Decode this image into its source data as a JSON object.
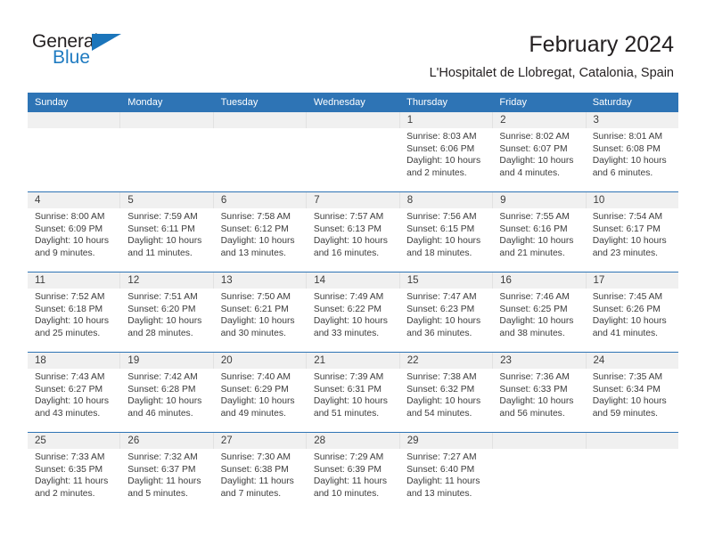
{
  "brand": {
    "name_part1": "General",
    "name_part2": "Blue",
    "triangle_icon": "triangle-icon",
    "accent_color": "#1b75bb"
  },
  "header": {
    "title": "February 2024",
    "subtitle": "L'Hospitalet de Llobregat, Catalonia, Spain"
  },
  "theme": {
    "header_blue": "#2e74b5",
    "daynum_strip": "#f0f0f0",
    "text": "#3c3c3c"
  },
  "calendar": {
    "weekday_headers": [
      "Sunday",
      "Monday",
      "Tuesday",
      "Wednesday",
      "Thursday",
      "Friday",
      "Saturday"
    ],
    "weeks": [
      {
        "days": [
          {
            "num": "",
            "sunrise": "",
            "sunset": "",
            "daylight_line1": "",
            "daylight_line2": ""
          },
          {
            "num": "",
            "sunrise": "",
            "sunset": "",
            "daylight_line1": "",
            "daylight_line2": ""
          },
          {
            "num": "",
            "sunrise": "",
            "sunset": "",
            "daylight_line1": "",
            "daylight_line2": ""
          },
          {
            "num": "",
            "sunrise": "",
            "sunset": "",
            "daylight_line1": "",
            "daylight_line2": ""
          },
          {
            "num": "1",
            "sunrise": "Sunrise: 8:03 AM",
            "sunset": "Sunset: 6:06 PM",
            "daylight_line1": "Daylight: 10 hours",
            "daylight_line2": "and 2 minutes."
          },
          {
            "num": "2",
            "sunrise": "Sunrise: 8:02 AM",
            "sunset": "Sunset: 6:07 PM",
            "daylight_line1": "Daylight: 10 hours",
            "daylight_line2": "and 4 minutes."
          },
          {
            "num": "3",
            "sunrise": "Sunrise: 8:01 AM",
            "sunset": "Sunset: 6:08 PM",
            "daylight_line1": "Daylight: 10 hours",
            "daylight_line2": "and 6 minutes."
          }
        ]
      },
      {
        "days": [
          {
            "num": "4",
            "sunrise": "Sunrise: 8:00 AM",
            "sunset": "Sunset: 6:09 PM",
            "daylight_line1": "Daylight: 10 hours",
            "daylight_line2": "and 9 minutes."
          },
          {
            "num": "5",
            "sunrise": "Sunrise: 7:59 AM",
            "sunset": "Sunset: 6:11 PM",
            "daylight_line1": "Daylight: 10 hours",
            "daylight_line2": "and 11 minutes."
          },
          {
            "num": "6",
            "sunrise": "Sunrise: 7:58 AM",
            "sunset": "Sunset: 6:12 PM",
            "daylight_line1": "Daylight: 10 hours",
            "daylight_line2": "and 13 minutes."
          },
          {
            "num": "7",
            "sunrise": "Sunrise: 7:57 AM",
            "sunset": "Sunset: 6:13 PM",
            "daylight_line1": "Daylight: 10 hours",
            "daylight_line2": "and 16 minutes."
          },
          {
            "num": "8",
            "sunrise": "Sunrise: 7:56 AM",
            "sunset": "Sunset: 6:15 PM",
            "daylight_line1": "Daylight: 10 hours",
            "daylight_line2": "and 18 minutes."
          },
          {
            "num": "9",
            "sunrise": "Sunrise: 7:55 AM",
            "sunset": "Sunset: 6:16 PM",
            "daylight_line1": "Daylight: 10 hours",
            "daylight_line2": "and 21 minutes."
          },
          {
            "num": "10",
            "sunrise": "Sunrise: 7:54 AM",
            "sunset": "Sunset: 6:17 PM",
            "daylight_line1": "Daylight: 10 hours",
            "daylight_line2": "and 23 minutes."
          }
        ]
      },
      {
        "days": [
          {
            "num": "11",
            "sunrise": "Sunrise: 7:52 AM",
            "sunset": "Sunset: 6:18 PM",
            "daylight_line1": "Daylight: 10 hours",
            "daylight_line2": "and 25 minutes."
          },
          {
            "num": "12",
            "sunrise": "Sunrise: 7:51 AM",
            "sunset": "Sunset: 6:20 PM",
            "daylight_line1": "Daylight: 10 hours",
            "daylight_line2": "and 28 minutes."
          },
          {
            "num": "13",
            "sunrise": "Sunrise: 7:50 AM",
            "sunset": "Sunset: 6:21 PM",
            "daylight_line1": "Daylight: 10 hours",
            "daylight_line2": "and 30 minutes."
          },
          {
            "num": "14",
            "sunrise": "Sunrise: 7:49 AM",
            "sunset": "Sunset: 6:22 PM",
            "daylight_line1": "Daylight: 10 hours",
            "daylight_line2": "and 33 minutes."
          },
          {
            "num": "15",
            "sunrise": "Sunrise: 7:47 AM",
            "sunset": "Sunset: 6:23 PM",
            "daylight_line1": "Daylight: 10 hours",
            "daylight_line2": "and 36 minutes."
          },
          {
            "num": "16",
            "sunrise": "Sunrise: 7:46 AM",
            "sunset": "Sunset: 6:25 PM",
            "daylight_line1": "Daylight: 10 hours",
            "daylight_line2": "and 38 minutes."
          },
          {
            "num": "17",
            "sunrise": "Sunrise: 7:45 AM",
            "sunset": "Sunset: 6:26 PM",
            "daylight_line1": "Daylight: 10 hours",
            "daylight_line2": "and 41 minutes."
          }
        ]
      },
      {
        "days": [
          {
            "num": "18",
            "sunrise": "Sunrise: 7:43 AM",
            "sunset": "Sunset: 6:27 PM",
            "daylight_line1": "Daylight: 10 hours",
            "daylight_line2": "and 43 minutes."
          },
          {
            "num": "19",
            "sunrise": "Sunrise: 7:42 AM",
            "sunset": "Sunset: 6:28 PM",
            "daylight_line1": "Daylight: 10 hours",
            "daylight_line2": "and 46 minutes."
          },
          {
            "num": "20",
            "sunrise": "Sunrise: 7:40 AM",
            "sunset": "Sunset: 6:29 PM",
            "daylight_line1": "Daylight: 10 hours",
            "daylight_line2": "and 49 minutes."
          },
          {
            "num": "21",
            "sunrise": "Sunrise: 7:39 AM",
            "sunset": "Sunset: 6:31 PM",
            "daylight_line1": "Daylight: 10 hours",
            "daylight_line2": "and 51 minutes."
          },
          {
            "num": "22",
            "sunrise": "Sunrise: 7:38 AM",
            "sunset": "Sunset: 6:32 PM",
            "daylight_line1": "Daylight: 10 hours",
            "daylight_line2": "and 54 minutes."
          },
          {
            "num": "23",
            "sunrise": "Sunrise: 7:36 AM",
            "sunset": "Sunset: 6:33 PM",
            "daylight_line1": "Daylight: 10 hours",
            "daylight_line2": "and 56 minutes."
          },
          {
            "num": "24",
            "sunrise": "Sunrise: 7:35 AM",
            "sunset": "Sunset: 6:34 PM",
            "daylight_line1": "Daylight: 10 hours",
            "daylight_line2": "and 59 minutes."
          }
        ]
      },
      {
        "days": [
          {
            "num": "25",
            "sunrise": "Sunrise: 7:33 AM",
            "sunset": "Sunset: 6:35 PM",
            "daylight_line1": "Daylight: 11 hours",
            "daylight_line2": "and 2 minutes."
          },
          {
            "num": "26",
            "sunrise": "Sunrise: 7:32 AM",
            "sunset": "Sunset: 6:37 PM",
            "daylight_line1": "Daylight: 11 hours",
            "daylight_line2": "and 5 minutes."
          },
          {
            "num": "27",
            "sunrise": "Sunrise: 7:30 AM",
            "sunset": "Sunset: 6:38 PM",
            "daylight_line1": "Daylight: 11 hours",
            "daylight_line2": "and 7 minutes."
          },
          {
            "num": "28",
            "sunrise": "Sunrise: 7:29 AM",
            "sunset": "Sunset: 6:39 PM",
            "daylight_line1": "Daylight: 11 hours",
            "daylight_line2": "and 10 minutes."
          },
          {
            "num": "29",
            "sunrise": "Sunrise: 7:27 AM",
            "sunset": "Sunset: 6:40 PM",
            "daylight_line1": "Daylight: 11 hours",
            "daylight_line2": "and 13 minutes."
          },
          {
            "num": "",
            "sunrise": "",
            "sunset": "",
            "daylight_line1": "",
            "daylight_line2": ""
          },
          {
            "num": "",
            "sunrise": "",
            "sunset": "",
            "daylight_line1": "",
            "daylight_line2": ""
          }
        ]
      }
    ]
  }
}
